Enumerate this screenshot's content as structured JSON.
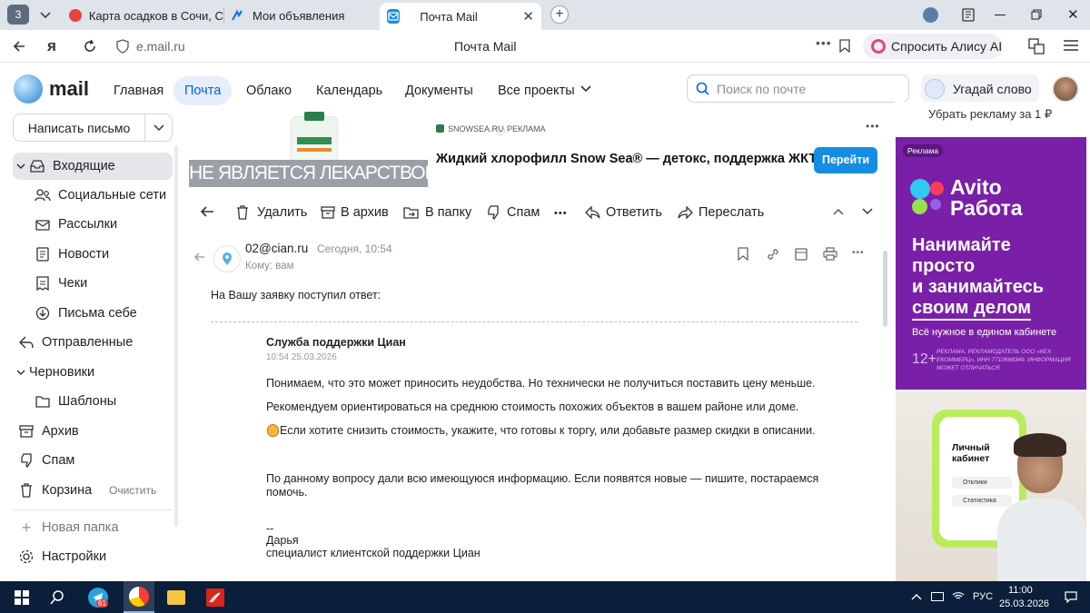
{
  "browser": {
    "tab_counter": "3",
    "tabs": [
      {
        "title": "Карта осадков в Сочи, Со",
        "icon": "globe-red-icon"
      },
      {
        "title": "Мои объявления",
        "icon": "avito-icon"
      },
      {
        "title": "Почта Mail",
        "icon": "mail-icon"
      }
    ],
    "address": "e.mail.ru",
    "page_title": "Почта Mail",
    "alice_label": "Спросить Алису AI"
  },
  "app": {
    "logo_text": "mail",
    "nav": [
      "Главная",
      "Почта",
      "Облако",
      "Календарь",
      "Документы",
      "Все проекты"
    ],
    "search_placeholder": "Поиск по почте",
    "guess_word": "Угадай слово"
  },
  "sidebar": {
    "compose": "Написать письмо",
    "items": [
      {
        "label": "Входящие",
        "icon": "inbox-icon"
      },
      {
        "label": "Социальные сети",
        "icon": "people-icon"
      },
      {
        "label": "Рассылки",
        "icon": "newsletter-icon"
      },
      {
        "label": "Новости",
        "icon": "news-icon"
      },
      {
        "label": "Чеки",
        "icon": "receipt-icon"
      },
      {
        "label": "Письма себе",
        "icon": "self-mail-icon"
      },
      {
        "label": "Отправленные",
        "icon": "sent-icon"
      },
      {
        "label": "Черновики",
        "icon": "drafts-icon"
      },
      {
        "label": "Шаблоны",
        "icon": "folder-icon"
      },
      {
        "label": "Архив",
        "icon": "archive-icon"
      },
      {
        "label": "Спам",
        "icon": "spam-icon"
      },
      {
        "label": "Корзина",
        "icon": "trash-icon"
      }
    ],
    "clear_label": "Очистить",
    "new_folder": "Новая папка",
    "settings": "Настройки"
  },
  "ad_top": {
    "source": "SNOWSEA.RU",
    "ad_label": "РЕКЛАМА",
    "headline": "Жидкий хлорофилл Snow Sea® — детокс, поддержка ЖКТ...",
    "button": "Перейти",
    "disclaimer": "НЕ ЯВЛЯЕТСЯ ЛЕКАРСТВОМ"
  },
  "toolbar": [
    "Удалить",
    "В архив",
    "В папку",
    "Спам",
    "Ответить",
    "Переслать"
  ],
  "message": {
    "from": "02@cian.ru",
    "date": "Сегодня, 10:54",
    "to": "Кому: вам",
    "intro": "На Вашу заявку поступил ответ:",
    "sender_name": "Служба поддержки Циан",
    "sent_time": "10:54 25.03.2026",
    "p1": "Понимаем, что это может приносить неудобства. Но технически не получиться поставить цену меньше.",
    "p2": "Рекомендуем ориентироваться на среднюю стоимость похожих объектов в вашем районе или доме.",
    "p3": "Если хотите снизить стоимость, укажите, что готовы к торгу, или добавьте размер скидки в описании.",
    "p4a": "По данному вопросу дали всю имеющуюся информацию. Если появятся новые  —  пишите, постараемся",
    "p4b": "помочь.",
    "sig_dash": "--",
    "sig_name": "Дарья",
    "sig_role": "специалист клиентской поддержки Циан"
  },
  "ad_right": {
    "remove_ads": "Убрать рекламу за 1 ₽",
    "label": "Реклама",
    "brand1": "Avito",
    "brand2": "Работа",
    "h1": "Нанимайте",
    "h2": "просто",
    "h3": "и занимайтесь",
    "h4": "своим делом",
    "sub": "Всё нужное в едином кабинете",
    "age": "12+",
    "fine": "РЕКЛАМА. РЕКЛАМОДАТЕЛЬ ООО «КЕХ ЕКОММЕРЦ», ИНН 7710668349. ИНФОРМАЦИЯ МОЖЕТ ОТЛИЧАТЬСЯ.",
    "card_title": "Личный кабинет",
    "card_row1": "Отклики",
    "card_row2": "Статистика"
  },
  "taskbar": {
    "lang": "РУС",
    "time": "11:00",
    "date": "25.03.2026",
    "telegram_badge": "61"
  }
}
